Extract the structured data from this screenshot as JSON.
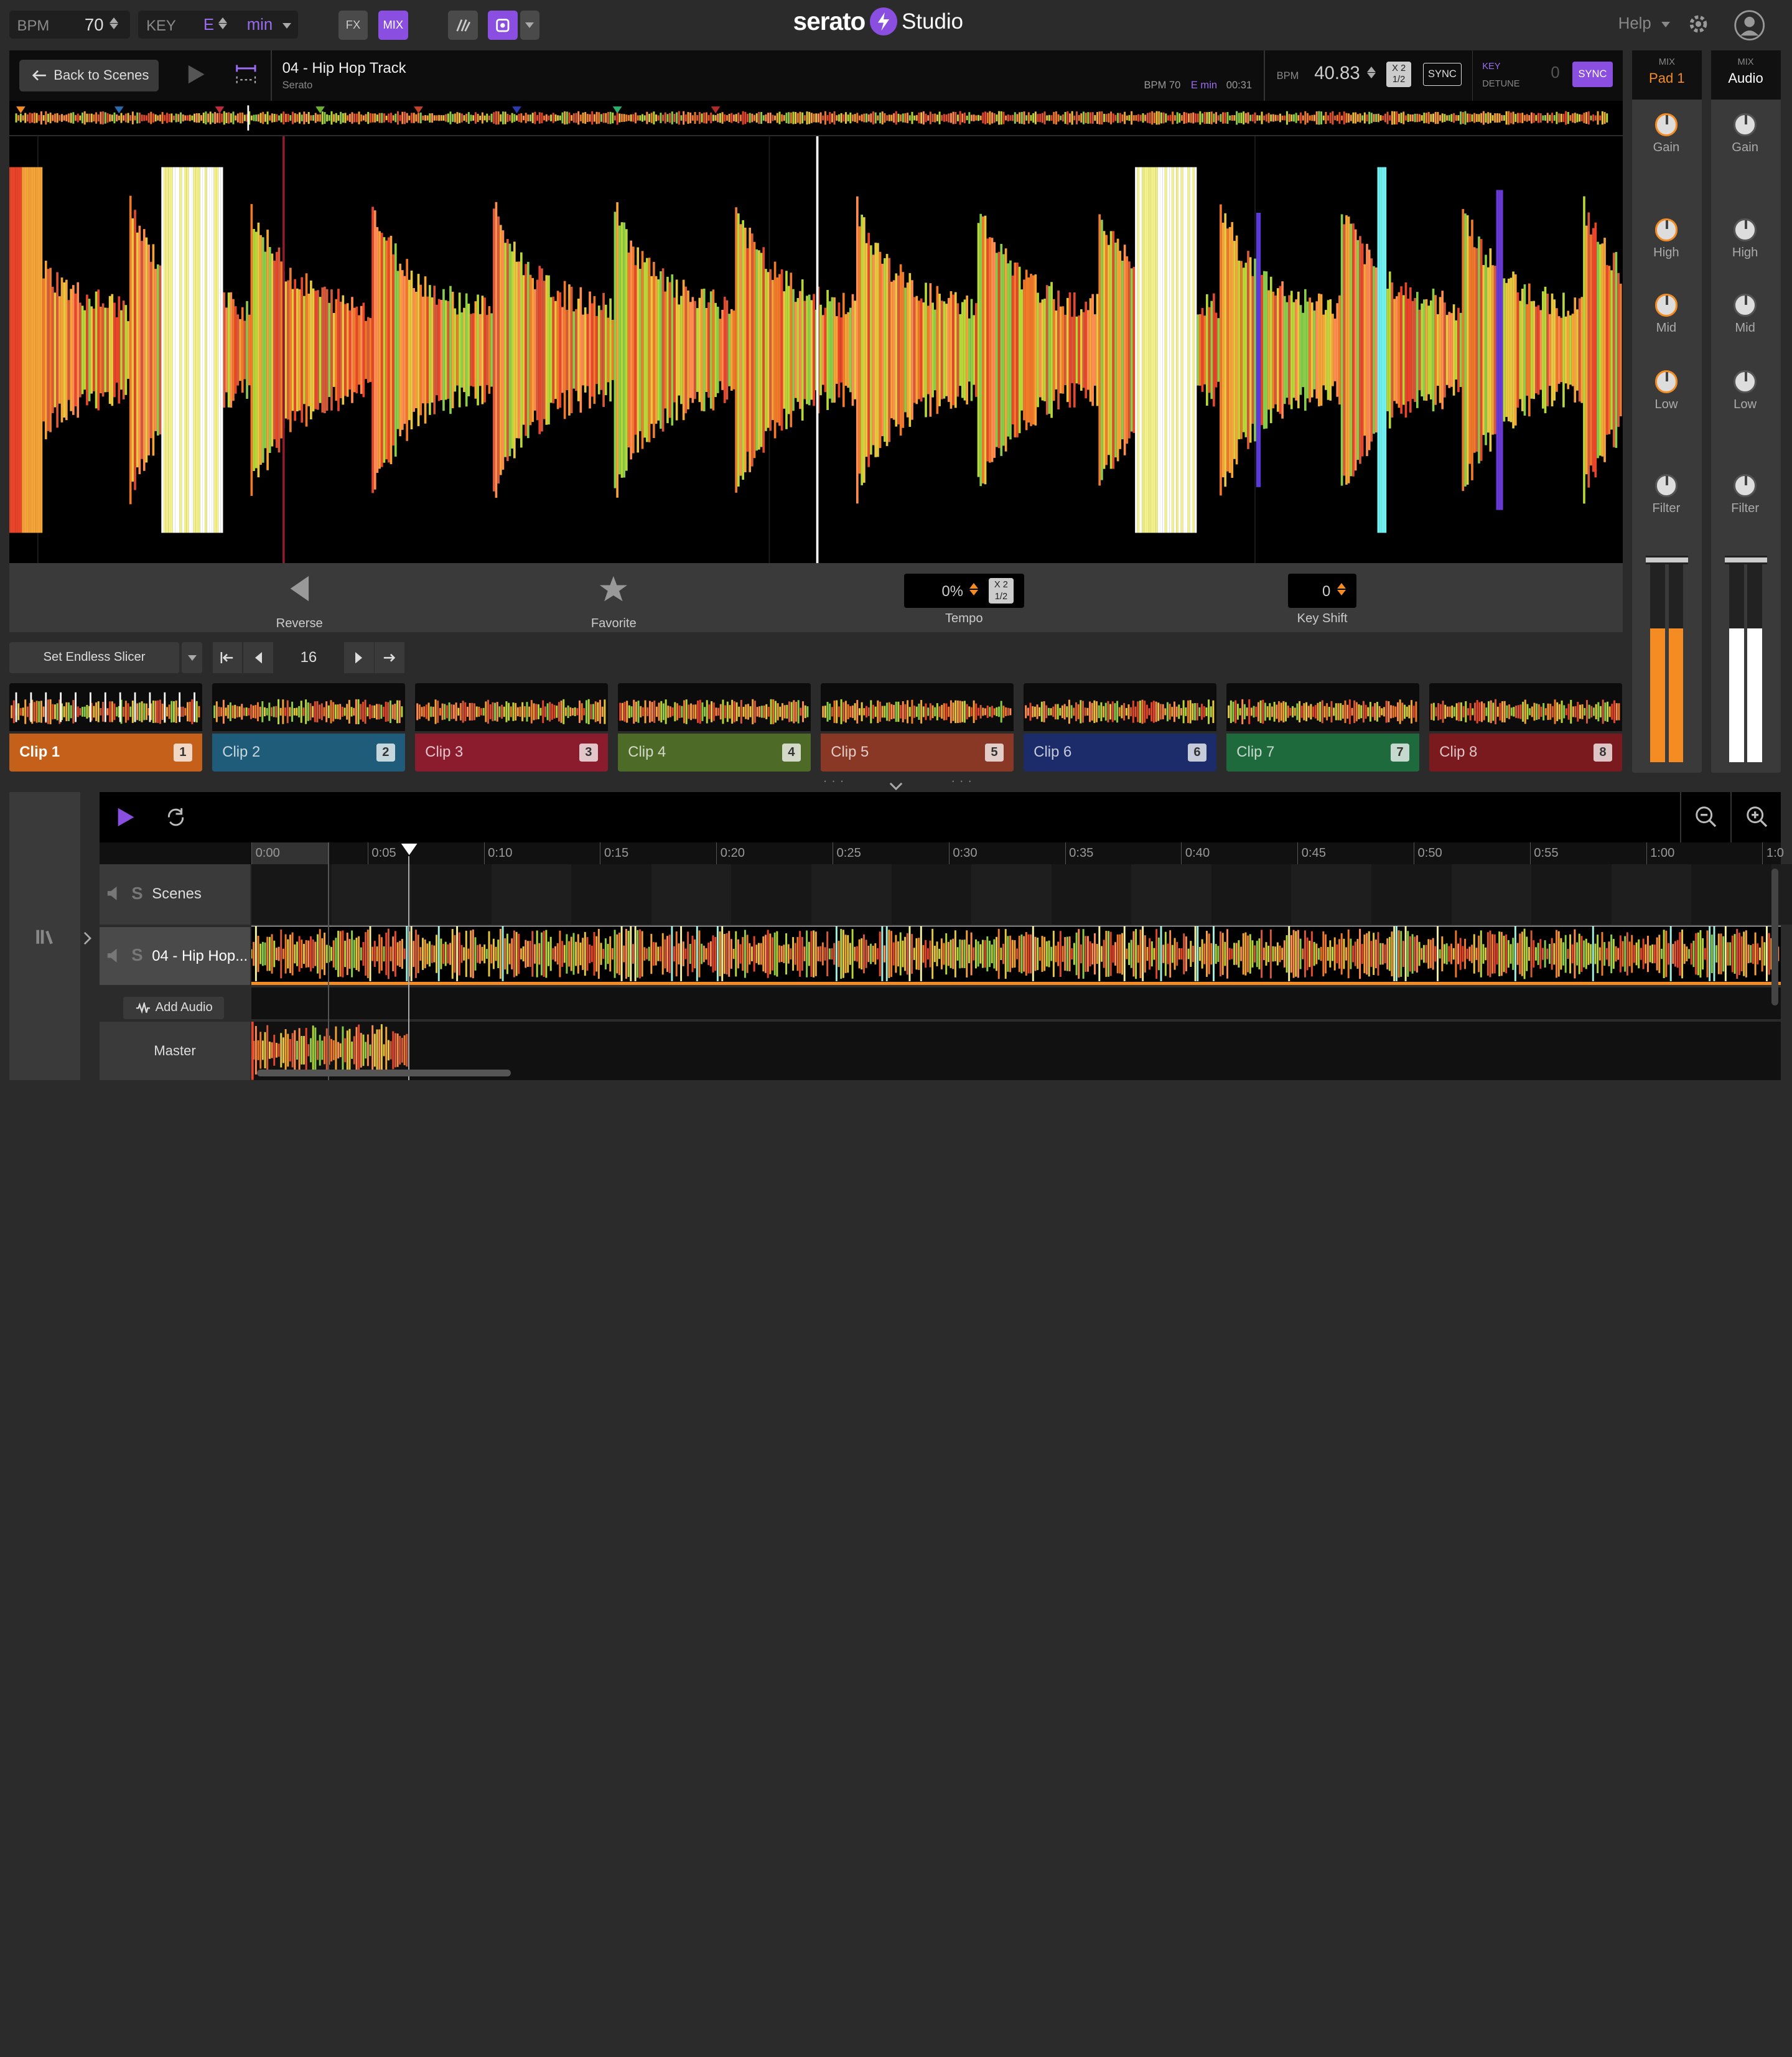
{
  "toolbar": {
    "bpm_label": "BPM",
    "bpm_value": "70",
    "key_label": "KEY",
    "key_value": "E",
    "key_mode": "min",
    "fx_label": "FX",
    "mix_label": "MIX",
    "logo_text": "serato",
    "logo_suffix": "Studio",
    "help_label": "Help"
  },
  "deck": {
    "back_label": "Back to Scenes",
    "track_title": "04 - Hip Hop Track",
    "track_artist": "Serato",
    "meta_bpm": "BPM 70",
    "meta_key": "E min",
    "meta_time": "00:31",
    "bpm_label": "BPM",
    "bpm_value": "40.83",
    "x2": "X 2",
    "half": "1/2",
    "sync_label": "SYNC",
    "key_label": "KEY",
    "detune_label": "DETUNE",
    "detune_value": "0",
    "key_sync_label": "SYNC"
  },
  "controls": {
    "reverse_label": "Reverse",
    "favorite_label": "Favorite",
    "tempo_value": "0%",
    "tempo_label": "Tempo",
    "tempo_x2": "X 2",
    "tempo_half": "1/2",
    "keyshift_value": "0",
    "keyshift_label": "Key Shift"
  },
  "slicer": {
    "mode_label": "Set Endless Slicer",
    "count": "16"
  },
  "clips": [
    {
      "label": "Clip 1",
      "num": "1",
      "color": "#c5601a",
      "active": true
    },
    {
      "label": "Clip 2",
      "num": "2",
      "color": "#1f5c7a"
    },
    {
      "label": "Clip 3",
      "num": "3",
      "color": "#8a1c2e"
    },
    {
      "label": "Clip 4",
      "num": "4",
      "color": "#4d6a26"
    },
    {
      "label": "Clip 5",
      "num": "5",
      "color": "#8a3826"
    },
    {
      "label": "Clip 6",
      "num": "6",
      "color": "#1c2c6a"
    },
    {
      "label": "Clip 7",
      "num": "7",
      "color": "#1f6a3c"
    },
    {
      "label": "Clip 8",
      "num": "8",
      "color": "#7a1a1e"
    }
  ],
  "mixer": {
    "pad": {
      "top": "MIX",
      "name": "Pad 1"
    },
    "audio": {
      "top": "MIX",
      "name": "Audio"
    },
    "knobs": [
      "Gain",
      "High",
      "Mid",
      "Low",
      "Filter"
    ],
    "pad_level": 0.65,
    "audio_level": 0.65
  },
  "arrangement": {
    "time_ticks": [
      "0:00",
      "0:05",
      "0:10",
      "0:15",
      "0:20",
      "0:25",
      "0:30",
      "0:35",
      "0:40",
      "0:45",
      "0:50",
      "0:55",
      "1:00",
      "1:0"
    ],
    "tracks": {
      "scenes": {
        "s": "S",
        "name": "Scenes"
      },
      "audio": {
        "s": "S",
        "name": "04 - Hip Hop..."
      }
    },
    "add_audio_label": "Add Audio",
    "master_label": "Master"
  },
  "colors": {
    "accent_purple": "#8a4fe0",
    "accent_orange": "#f58c23"
  }
}
